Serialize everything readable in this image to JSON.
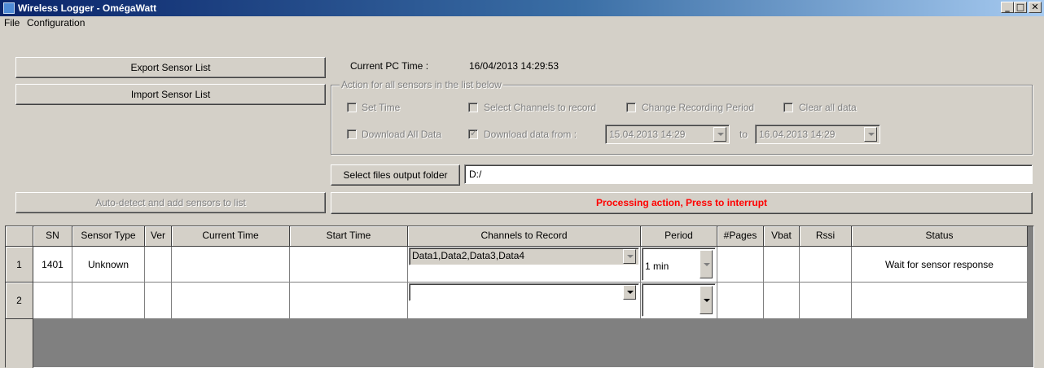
{
  "window": {
    "title": "Wireless Logger - OmégaWatt",
    "min_glyph": "_",
    "max_glyph": "□",
    "close_glyph": "✕"
  },
  "menu": [
    "File",
    "Configuration"
  ],
  "buttons": {
    "export": "Export Sensor List",
    "import": "Import Sensor List",
    "autodetect": "Auto-detect and add sensors to list",
    "output_folder": "Select files output folder",
    "process": "Processing action, Press to interrupt"
  },
  "pc_time": {
    "label": "Current PC Time :",
    "value": "16/04/2013 14:29:53"
  },
  "action_group": {
    "legend": "Action for all sensors in the list below",
    "set_time": "Set Time",
    "select_channels": "Select Channels to record",
    "change_period": "Change Recording Period",
    "clear_all": "Clear all data",
    "download_all": "Download All Data",
    "download_from": "Download data from :",
    "from_date": "15.04.2013  14:29",
    "to_label": "to",
    "to_date": "16.04.2013  14:29",
    "checked": {
      "set_time": false,
      "select_channels": false,
      "change_period": false,
      "clear_all": false,
      "download_all": false,
      "download_from": true
    }
  },
  "output_folder_path": "D:/",
  "colors": {
    "process_text": "#ff0000",
    "face": "#d4d0c8"
  },
  "table": {
    "columns": [
      "SN",
      "Sensor Type",
      "Ver",
      "Current Time",
      "Start Time",
      "Channels to Record",
      "Period",
      "#Pages",
      "Vbat",
      "Rssi",
      "Status"
    ],
    "rows": [
      {
        "num": "1",
        "sn": "1401",
        "type": "Unknown",
        "ver": "",
        "current": "",
        "start": "",
        "channels": "Data1,Data2,Data3,Data4",
        "period": "1 min",
        "pages": "",
        "vbat": "",
        "rssi": "",
        "status": "Wait for sensor response"
      },
      {
        "num": "2",
        "sn": "",
        "type": "",
        "ver": "",
        "current": "",
        "start": "",
        "channels": "",
        "period": "",
        "pages": "",
        "vbat": "",
        "rssi": "",
        "status": ""
      }
    ]
  }
}
